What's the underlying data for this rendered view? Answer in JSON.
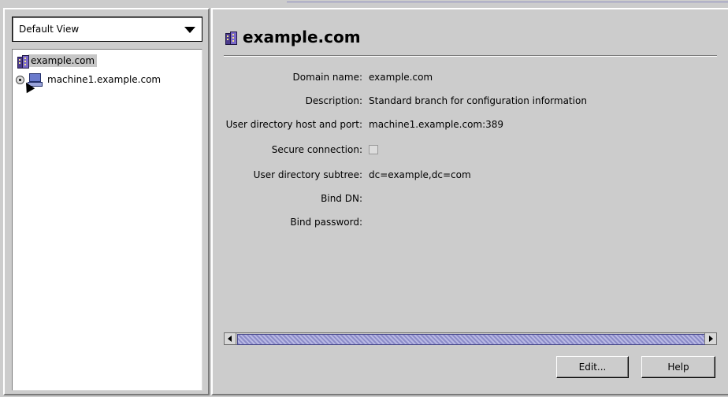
{
  "view_selector": {
    "selected": "Default View"
  },
  "tree": {
    "items": [
      {
        "label": "example.com",
        "icon": "building-icon",
        "selected": true
      },
      {
        "label": "machine1.example.com",
        "icon": "computer-icon"
      }
    ]
  },
  "detail": {
    "title": "example.com",
    "properties": [
      {
        "label": "Domain name:",
        "value": "example.com"
      },
      {
        "label": "Description:",
        "value": "Standard branch for configuration information"
      },
      {
        "label": "User directory host and port:",
        "value": "machine1.example.com:389"
      },
      {
        "label": "Secure connection:",
        "value": "",
        "checkbox": true,
        "checked": false
      },
      {
        "label": "User directory subtree:",
        "value": "dc=example,dc=com"
      },
      {
        "label": "Bind DN:",
        "value": ""
      },
      {
        "label": "Bind password:",
        "value": ""
      }
    ]
  },
  "buttons": {
    "edit": "Edit...",
    "help": "Help"
  },
  "colors": {
    "selection_bg": "#c6c6c6",
    "scrollbar_thumb": "#8c8cc8",
    "panel_bg": "#cccccc"
  }
}
